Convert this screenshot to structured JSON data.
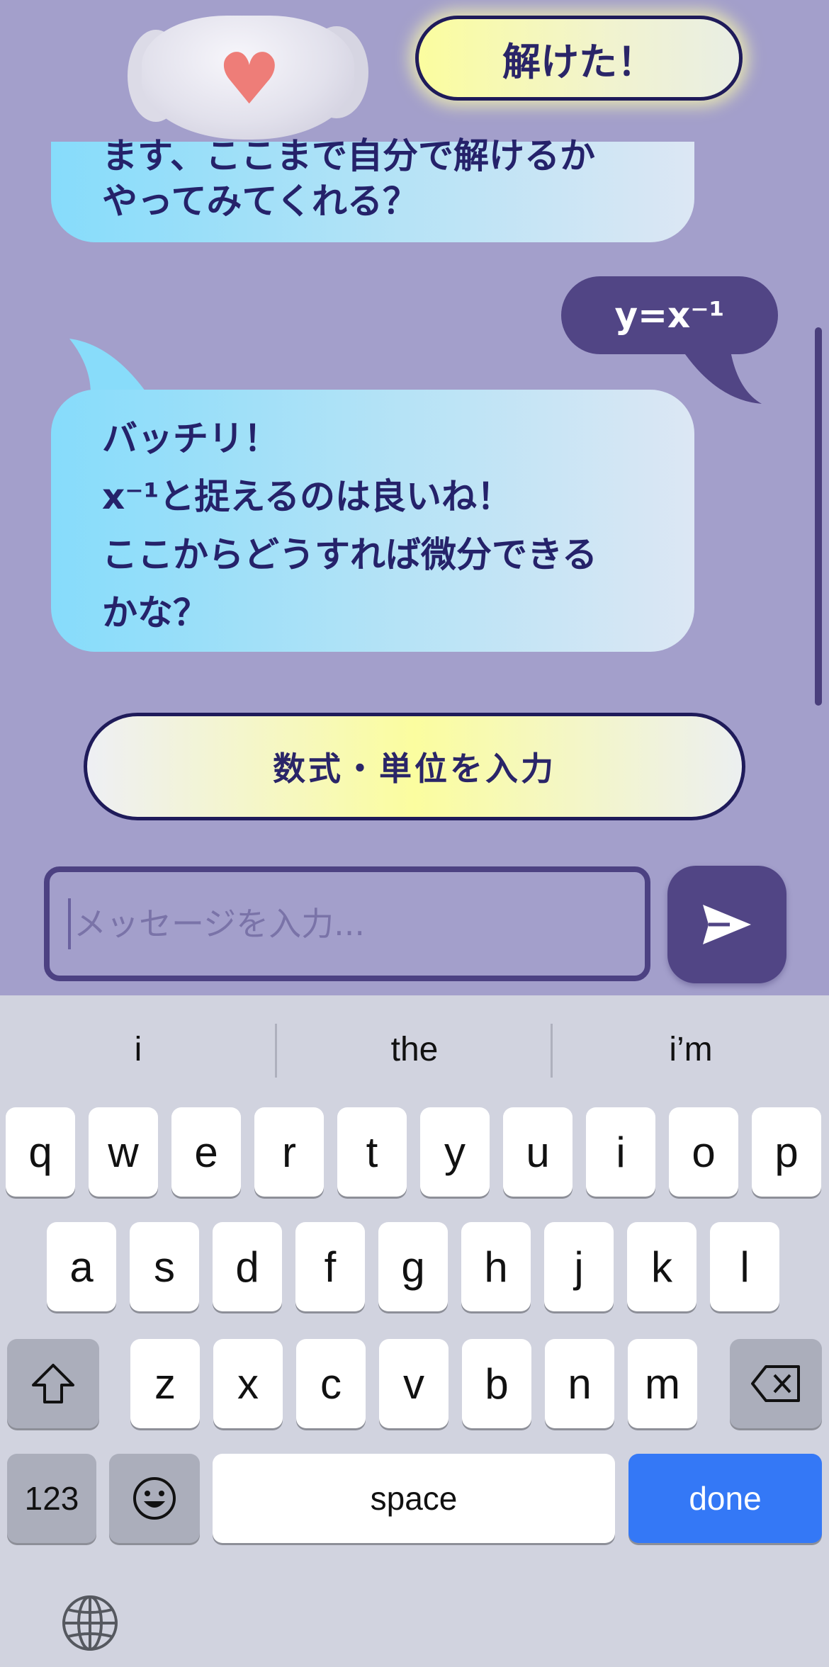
{
  "chat": {
    "solved_button": "解けた！",
    "bot_message_1": {
      "line1": "ます、ここまで自分で解けるか",
      "line2": "やってみてくれる？"
    },
    "user_message": "y=x⁻¹",
    "bot_message_2": {
      "line1": "バッチリ！",
      "line2": "x⁻¹と捉えるのは良いね！",
      "line3": "ここからどうすれば微分できる",
      "line4": "かな？"
    },
    "math_input_button": "数式・単位を入力",
    "input_placeholder": "メッセージを入力..."
  },
  "keyboard": {
    "suggestions": [
      "i",
      "the",
      "i’m"
    ],
    "row1": [
      "q",
      "w",
      "e",
      "r",
      "t",
      "y",
      "u",
      "i",
      "o",
      "p"
    ],
    "row2": [
      "a",
      "s",
      "d",
      "f",
      "g",
      "h",
      "j",
      "k",
      "l"
    ],
    "row3": [
      "z",
      "x",
      "c",
      "v",
      "b",
      "n",
      "m"
    ],
    "numbers_key": "123",
    "space_key": "space",
    "done_key": "done"
  },
  "colors": {
    "background": "#a39fcb",
    "accent_dark": "#514585",
    "bubble_gradient_start": "#86dcfb",
    "button_yellow": "#fbfd9f",
    "done_blue": "#3478f6"
  }
}
